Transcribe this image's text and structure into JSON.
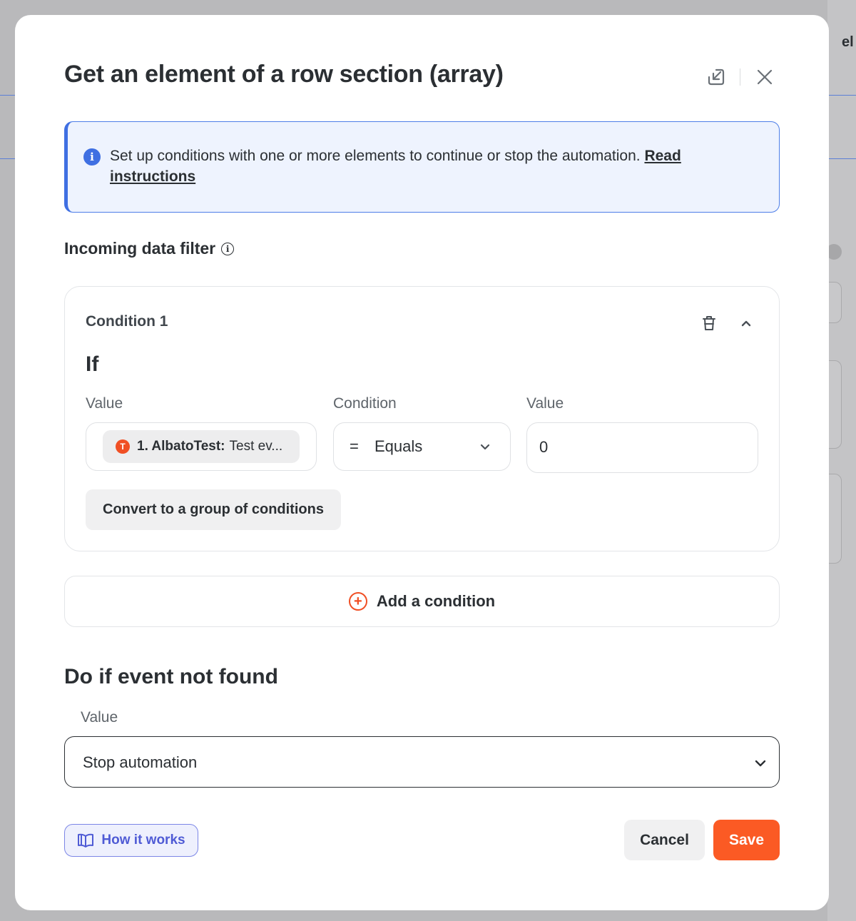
{
  "background": {
    "right_fragment_text": "el"
  },
  "modal": {
    "title": "Get an element of a row section (array)",
    "header_icons": [
      "expand-icon",
      "close-icon"
    ]
  },
  "info_banner": {
    "text": "Set up conditions with one or more elements to continue or stop the automation.",
    "link": "Read instructions"
  },
  "filter": {
    "label": "Incoming data filter",
    "condition": {
      "title": "Condition 1",
      "if_label": "If",
      "columns": {
        "value_left": "Value",
        "condition": "Condition",
        "value_right": "Value"
      },
      "value_chip": {
        "prefix": "1. AlbatoTest:",
        "text": "Test ev..."
      },
      "operator": {
        "symbol": "=",
        "label": "Equals"
      },
      "compare_value": "0",
      "convert_button": "Convert to a group of conditions"
    },
    "add_condition": "Add a condition"
  },
  "not_found": {
    "title": "Do if event not found",
    "value_label": "Value",
    "selected": "Stop automation"
  },
  "footer": {
    "how_it_works": "How it works",
    "cancel": "Cancel",
    "save": "Save"
  },
  "colors": {
    "accent_orange": "#fb5a24",
    "info_blue": "#3f6fe2",
    "link_purple": "#4f5bd5"
  }
}
